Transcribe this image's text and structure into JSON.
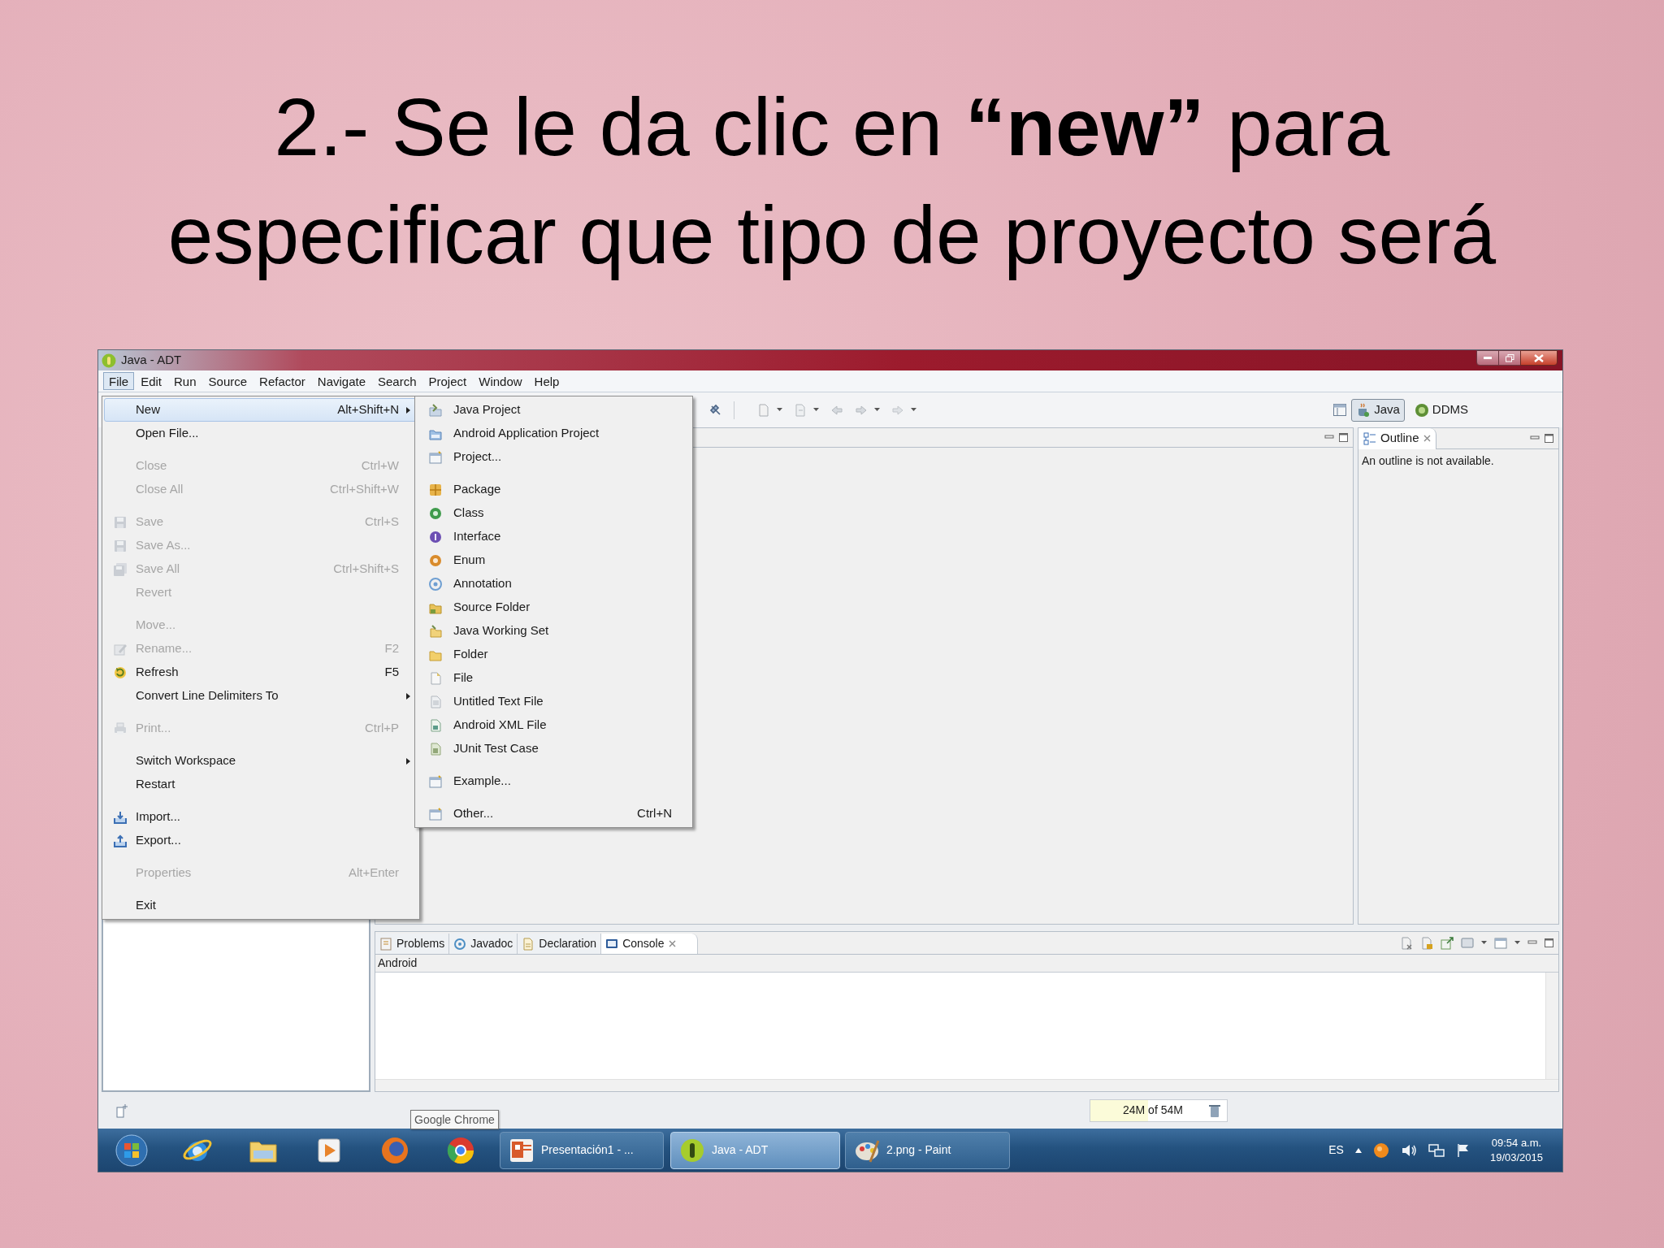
{
  "slide": {
    "title": "2.- Se le da clic en **“new”** para especificar que tipo de proyecto será"
  },
  "window": {
    "title": "Java - ADT"
  },
  "menu_bar": [
    {
      "label": "File",
      "selected": true
    },
    {
      "label": "Edit",
      "selected": false
    },
    {
      "label": "Run",
      "selected": false
    },
    {
      "label": "Source",
      "selected": false
    },
    {
      "label": "Refactor",
      "selected": false
    },
    {
      "label": "Navigate",
      "selected": false
    },
    {
      "label": "Search",
      "selected": false
    },
    {
      "label": "Project",
      "selected": false
    },
    {
      "label": "Window",
      "selected": false
    },
    {
      "label": "Help",
      "selected": false
    }
  ],
  "file_menu": [
    {
      "kind": "item",
      "label": "New",
      "shortcut": "Alt+Shift+N",
      "submenu": true,
      "disabled": false,
      "selected": true
    },
    {
      "kind": "item",
      "label": "Open File...",
      "submenu": false,
      "disabled": false,
      "selected": false
    },
    {
      "kind": "separator"
    },
    {
      "kind": "item",
      "label": "Close",
      "shortcut": "Ctrl+W",
      "submenu": false,
      "disabled": true,
      "selected": false
    },
    {
      "kind": "item",
      "label": "Close All",
      "shortcut": "Ctrl+Shift+W",
      "submenu": false,
      "disabled": true,
      "selected": false
    },
    {
      "kind": "separator"
    },
    {
      "kind": "item",
      "label": "Save",
      "shortcut": "Ctrl+S",
      "submenu": false,
      "disabled": true,
      "selected": false
    },
    {
      "kind": "item",
      "label": "Save As...",
      "submenu": false,
      "disabled": true,
      "selected": false
    },
    {
      "kind": "item",
      "label": "Save All",
      "shortcut": "Ctrl+Shift+S",
      "submenu": false,
      "disabled": true,
      "selected": false
    },
    {
      "kind": "item",
      "label": "Revert",
      "submenu": false,
      "disabled": true,
      "selected": false
    },
    {
      "kind": "separator"
    },
    {
      "kind": "item",
      "label": "Move...",
      "submenu": false,
      "disabled": true,
      "selected": false
    },
    {
      "kind": "item",
      "label": "Rename...",
      "shortcut": "F2",
      "submenu": false,
      "disabled": true,
      "selected": false
    },
    {
      "kind": "item",
      "label": "Refresh",
      "shortcut": "F5",
      "submenu": false,
      "disabled": false,
      "selected": false
    },
    {
      "kind": "item",
      "label": "Convert Line Delimiters To",
      "submenu": true,
      "disabled": false,
      "selected": false
    },
    {
      "kind": "separator"
    },
    {
      "kind": "item",
      "label": "Print...",
      "shortcut": "Ctrl+P",
      "submenu": false,
      "disabled": true,
      "selected": false
    },
    {
      "kind": "separator"
    },
    {
      "kind": "item",
      "label": "Switch Workspace",
      "submenu": true,
      "disabled": false,
      "selected": false
    },
    {
      "kind": "item",
      "label": "Restart",
      "submenu": false,
      "disabled": false,
      "selected": false
    },
    {
      "kind": "separator"
    },
    {
      "kind": "item",
      "label": "Import...",
      "submenu": false,
      "disabled": false,
      "selected": false
    },
    {
      "kind": "item",
      "label": "Export...",
      "submenu": false,
      "disabled": false,
      "selected": false
    },
    {
      "kind": "separator"
    },
    {
      "kind": "item",
      "label": "Properties",
      "shortcut": "Alt+Enter",
      "submenu": false,
      "disabled": true,
      "selected": false
    },
    {
      "kind": "separator"
    },
    {
      "kind": "item",
      "label": "Exit",
      "submenu": false,
      "disabled": false,
      "selected": false
    }
  ],
  "new_submenu": [
    {
      "kind": "item",
      "label": "Java Project"
    },
    {
      "kind": "item",
      "label": "Android Application Project"
    },
    {
      "kind": "item",
      "label": "Project..."
    },
    {
      "kind": "separator"
    },
    {
      "kind": "item",
      "label": "Package"
    },
    {
      "kind": "item",
      "label": "Class"
    },
    {
      "kind": "item",
      "label": "Interface"
    },
    {
      "kind": "item",
      "label": "Enum"
    },
    {
      "kind": "item",
      "label": "Annotation"
    },
    {
      "kind": "item",
      "label": "Source Folder"
    },
    {
      "kind": "item",
      "label": "Java Working Set"
    },
    {
      "kind": "item",
      "label": "Folder"
    },
    {
      "kind": "item",
      "label": "File"
    },
    {
      "kind": "item",
      "label": "Untitled Text File"
    },
    {
      "kind": "item",
      "label": "Android XML File"
    },
    {
      "kind": "item",
      "label": "JUnit Test Case"
    },
    {
      "kind": "separator"
    },
    {
      "kind": "item",
      "label": "Example..."
    },
    {
      "kind": "separator"
    },
    {
      "kind": "item",
      "label": "Other...",
      "shortcut": "Ctrl+N"
    }
  ],
  "perspectives": [
    {
      "label": "Java",
      "selected": true
    },
    {
      "label": "DDMS",
      "selected": false
    }
  ],
  "outline": {
    "tab": "Outline",
    "message": "An outline is not available."
  },
  "bottom_panel": {
    "tabs": [
      {
        "label": "Problems",
        "selected": false
      },
      {
        "label": "Javadoc",
        "selected": false
      },
      {
        "label": "Declaration",
        "selected": false
      },
      {
        "label": "Console",
        "selected": true
      }
    ],
    "console_name": "Android"
  },
  "status_bar": {
    "tooltip": "Google Chrome",
    "heap": {
      "reading": "24M of 54M",
      "level": 0.42
    }
  },
  "taskbar": {
    "windows": [
      {
        "label": "Presentación1 - ...",
        "selected": false
      },
      {
        "label": "Java - ADT",
        "selected": true
      },
      {
        "label": "2.png - Paint",
        "selected": false
      }
    ],
    "language": "ES",
    "time": "09:54 a.m.",
    "date": "19/03/2015"
  }
}
